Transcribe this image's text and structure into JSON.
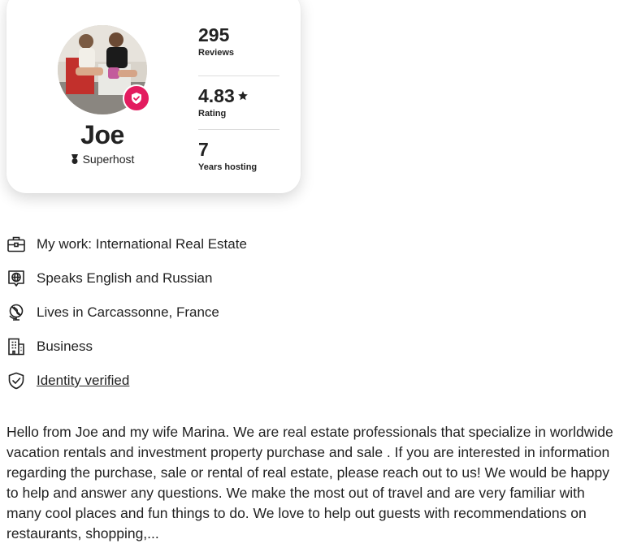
{
  "profile": {
    "name": "Joe",
    "superhost_label": "Superhost",
    "accent_color": "#e31c5f"
  },
  "stats": [
    {
      "value": "295",
      "label": "Reviews"
    },
    {
      "value": "4.83",
      "label": "Rating"
    },
    {
      "value": "7",
      "label": "Years hosting"
    }
  ],
  "facts": [
    {
      "icon": "briefcase-icon",
      "text": "My work: International Real Estate"
    },
    {
      "icon": "speech-globe-icon",
      "text": "Speaks English and Russian"
    },
    {
      "icon": "globe-pin-icon",
      "text": "Lives in Carcassonne, France"
    },
    {
      "icon": "building-icon",
      "text": "Business"
    },
    {
      "icon": "shield-check-icon",
      "text": "Identity verified"
    }
  ],
  "bio": "Hello from Joe and my wife Marina. We are real estate professionals that specialize in worldwide vacation rentals and investment property purchase and sale . If you are interested in information regarding the purchase, sale or rental of real estate, please reach out to us! We would be happy to help and answer any questions.  We make the most out of travel and are very familiar with many cool places and fun things to do. We love to help out guests with recommendations on restaurants, shopping,..."
}
